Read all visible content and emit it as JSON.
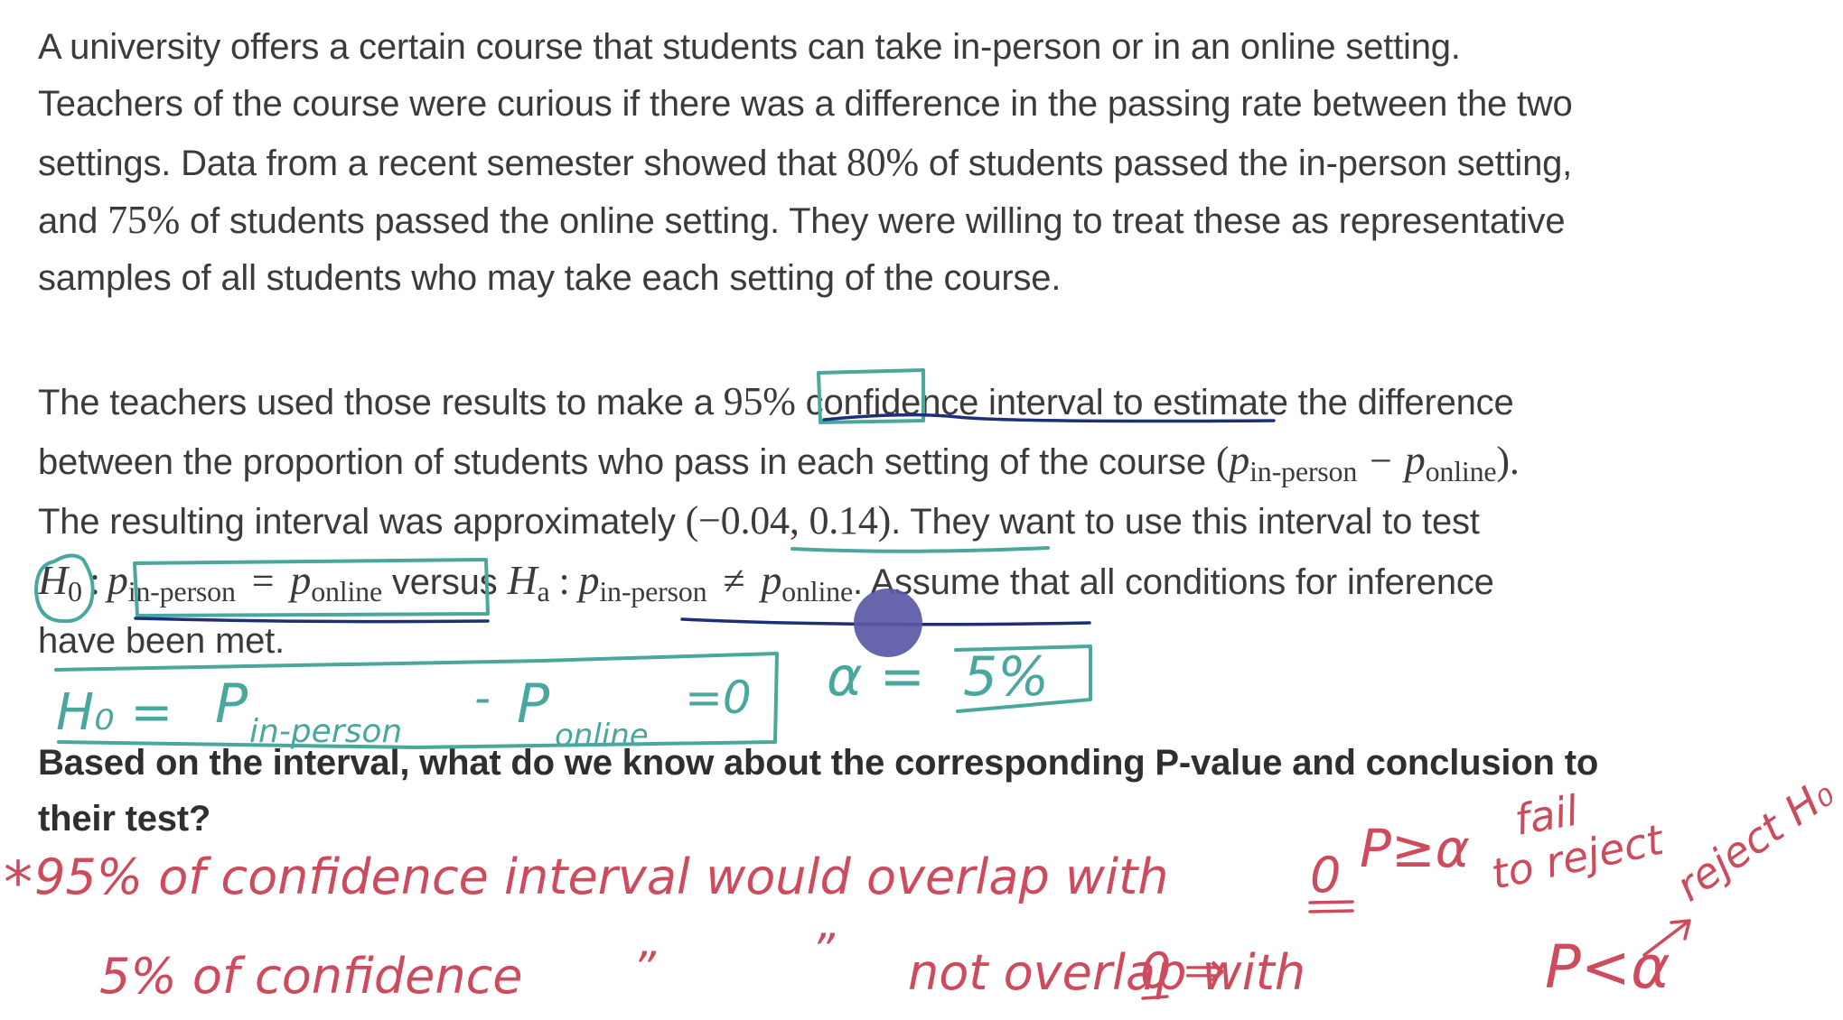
{
  "paragraph1": {
    "lines": [
      "A university offers a certain course that students can take in-person or in an online setting.",
      "Teachers of the course were curious if there was a difference in the passing rate between the two",
      {
        "pre": "settings. Data from a recent semester showed that ",
        "num": "80%",
        "post": " of students passed the in-person setting,"
      },
      {
        "pre": "and ",
        "num": "75%",
        "post": " of students passed the online setting. They were willing to treat these as representative"
      },
      "samples of all students who may take each setting of the course."
    ]
  },
  "paragraph2": {
    "line1": {
      "pre": "The teachers used those results to make a ",
      "num": "95%",
      "mid": " confidence interval",
      "post": " to estimate the difference"
    },
    "line2": {
      "pre": "between the proportion of students who pass in each setting of the course ",
      "p": "p",
      "sub1": "in-person",
      "minus": "−",
      "sub2": "online",
      "open": "(",
      "close": ").",
      "end": ""
    },
    "line3": {
      "pre": "The resulting interval was approximately ",
      "interval": "(−0.04, 0.14)",
      "post": ". They want to use this interval to test"
    },
    "line4": {
      "h0": "H",
      "h0sub": "0",
      "colon": ":",
      "p": "p",
      "sub_inperson": "in-person",
      "eq": "=",
      "sub_online": "online",
      "versus": " versus ",
      "ha": "H",
      "hasub": "a",
      "neq": "≠",
      "post": ". Assume that all conditions for inference"
    },
    "line5": "have been met."
  },
  "question": {
    "line1": "Based on the interval, what do we know about the corresponding P-value and conclusion to",
    "line2": "their test?"
  },
  "annotations": {
    "h0_note": {
      "h": "H₀ =",
      "p1": "P",
      "sub1": "in-person",
      "minus": "-",
      "p2": "P",
      "sub2": "online",
      "eq0": "=0"
    },
    "alpha_note": {
      "alpha": "α =",
      "value": "5%"
    },
    "red_line1": {
      "star": "*",
      "text": "95% of confidence interval would overlap with",
      "zero": "0",
      "cond": "P≥α",
      "conclusion_a": "fail",
      "conclusion_b": "to reject"
    },
    "red_line2": {
      "text": "5% of confidence",
      "ditto1": "”",
      "ditto2": "”",
      "text2": "not overlap with",
      "zero": "0",
      "arrow": "⇒",
      "cond": "P<α",
      "conclusion": "reject H₀"
    }
  },
  "colors": {
    "text": "#3b3b3b",
    "teal_ink": "#4aa79e",
    "navy_ink": "#1e2f7a",
    "red_ink": "#cc4b5c",
    "cursor": "#5a59a6"
  }
}
